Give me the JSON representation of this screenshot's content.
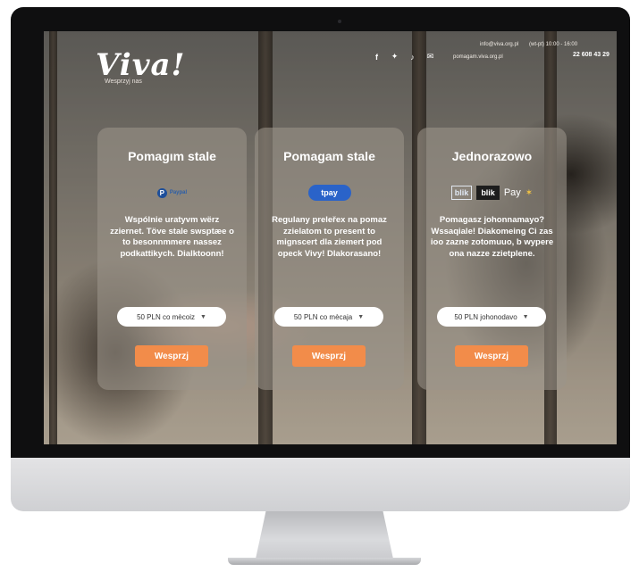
{
  "header": {
    "logo": "Viva!",
    "tagline": "Wesprzyj nas",
    "site_url": "pomagam.viva.org.pl",
    "contact_email": "info@viva.org.pl",
    "hours": "(wt-pt) 10:00 - 16:00",
    "phone": "22 608 43 29",
    "social_icons": [
      "facebook-icon",
      "twitter-icon",
      "tiktok-icon",
      "mail-icon"
    ]
  },
  "cards": [
    {
      "title": "Pomagım stale",
      "payment": "Paypal",
      "description": "Wspólnie uratyvm wërz zziernet. Töve stale swsptæe o to besonnmmere nassez podkattikych. Dialktoonn!",
      "select_value": "50 PLN co mècoiz",
      "button_label": "Wesprzj"
    },
    {
      "title": "Pomagam stale",
      "payment": "tpay",
      "description": "Regulany preleřex na pomaz zzielatom to present to mignscert dla ziemert pod opeck Vivy! Dlakorasano!",
      "select_value": "50 PLN co mècaja",
      "button_label": "Wesprzj"
    },
    {
      "title": "Jednorazowo",
      "payment_blik_outline": "blik",
      "payment_blik": "blik",
      "payment_gpay": "Pay",
      "description": "Pomagasz johonnamayo? Wssaqiale! Diakomeing Ci zas ioo zazne zotomuuo, b wypere ona nazze zzietplene.",
      "select_value": "50 PLN johonodavo",
      "button_label": "Wesprzj"
    }
  ],
  "colors": {
    "accent": "#f28c4a",
    "tpay_blue": "#2a63c9",
    "card_bg": "#9b948a"
  }
}
